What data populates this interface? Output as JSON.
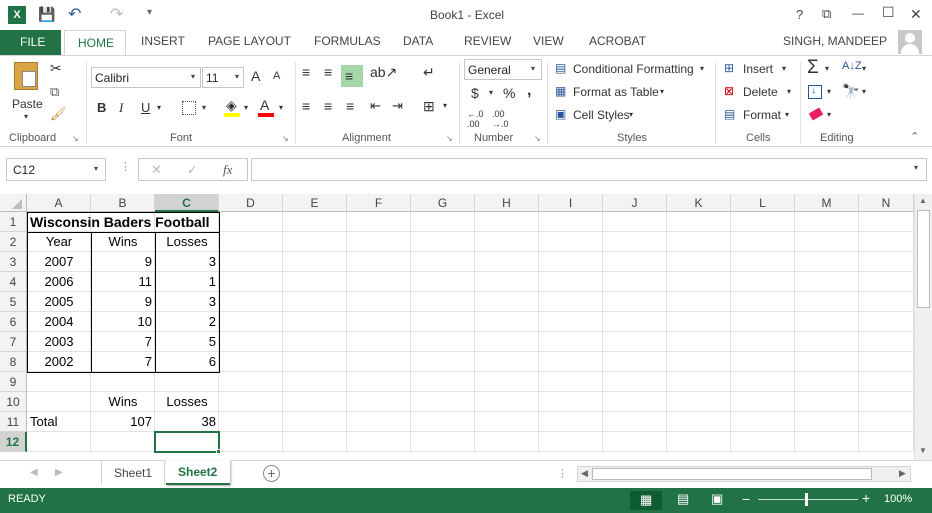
{
  "window": {
    "title": "Book1 - Excel",
    "help": "?",
    "ribbon_display": "⧉",
    "minimize": "—",
    "maximize": "☐",
    "close": "✕"
  },
  "quick_access": {
    "save": "💾",
    "undo": "↶",
    "redo": "↷",
    "customize": "▾"
  },
  "ribbon_tabs": [
    "FILE",
    "HOME",
    "INSERT",
    "PAGE LAYOUT",
    "FORMULAS",
    "DATA",
    "REVIEW",
    "VIEW",
    "ACROBAT"
  ],
  "user": "SINGH, MANDEEP",
  "ribbon": {
    "clipboard": {
      "label": "Clipboard",
      "paste": "Paste"
    },
    "font": {
      "label": "Font",
      "name": "Calibri",
      "size": "11",
      "bold": "B",
      "italic": "I",
      "underline": "U",
      "grow": "A",
      "shrink": "A"
    },
    "alignment": {
      "label": "Alignment"
    },
    "number": {
      "label": "Number",
      "format": "General",
      "currency": "$",
      "percent": "%",
      "comma": ","
    },
    "styles": {
      "label": "Styles",
      "conditional": "Conditional Formatting",
      "format_table": "Format as Table",
      "cell_styles": "Cell Styles"
    },
    "cells": {
      "label": "Cells",
      "insert": "Insert",
      "delete": "Delete",
      "format": "Format"
    },
    "editing": {
      "label": "Editing",
      "sum": "Σ"
    }
  },
  "formula_bar": {
    "name_box": "C12",
    "cancel": "✕",
    "enter": "✓",
    "fx": "fx",
    "value": ""
  },
  "columns": [
    "A",
    "B",
    "C",
    "D",
    "E",
    "F",
    "G",
    "H",
    "I",
    "J",
    "K",
    "L",
    "M",
    "N"
  ],
  "rows": [
    "1",
    "2",
    "3",
    "4",
    "5",
    "6",
    "7",
    "8",
    "9",
    "10",
    "11",
    "12"
  ],
  "cells": {
    "title": "Wisconsin Baders Football",
    "h_year": "Year",
    "h_wins": "Wins",
    "h_losses": "Losses",
    "data": [
      [
        "2007",
        "9",
        "3"
      ],
      [
        "2006",
        "11",
        "1"
      ],
      [
        "2005",
        "9",
        "3"
      ],
      [
        "2004",
        "10",
        "2"
      ],
      [
        "2003",
        "7",
        "5"
      ],
      [
        "2002",
        "7",
        "6"
      ]
    ],
    "b10": "Wins",
    "c10": "Losses",
    "a11": "Total",
    "b11": "107",
    "c11": "38"
  },
  "sheets": [
    "Sheet1",
    "Sheet2"
  ],
  "active_sheet": "Sheet2",
  "status": {
    "mode": "READY",
    "zoom": "100%"
  }
}
